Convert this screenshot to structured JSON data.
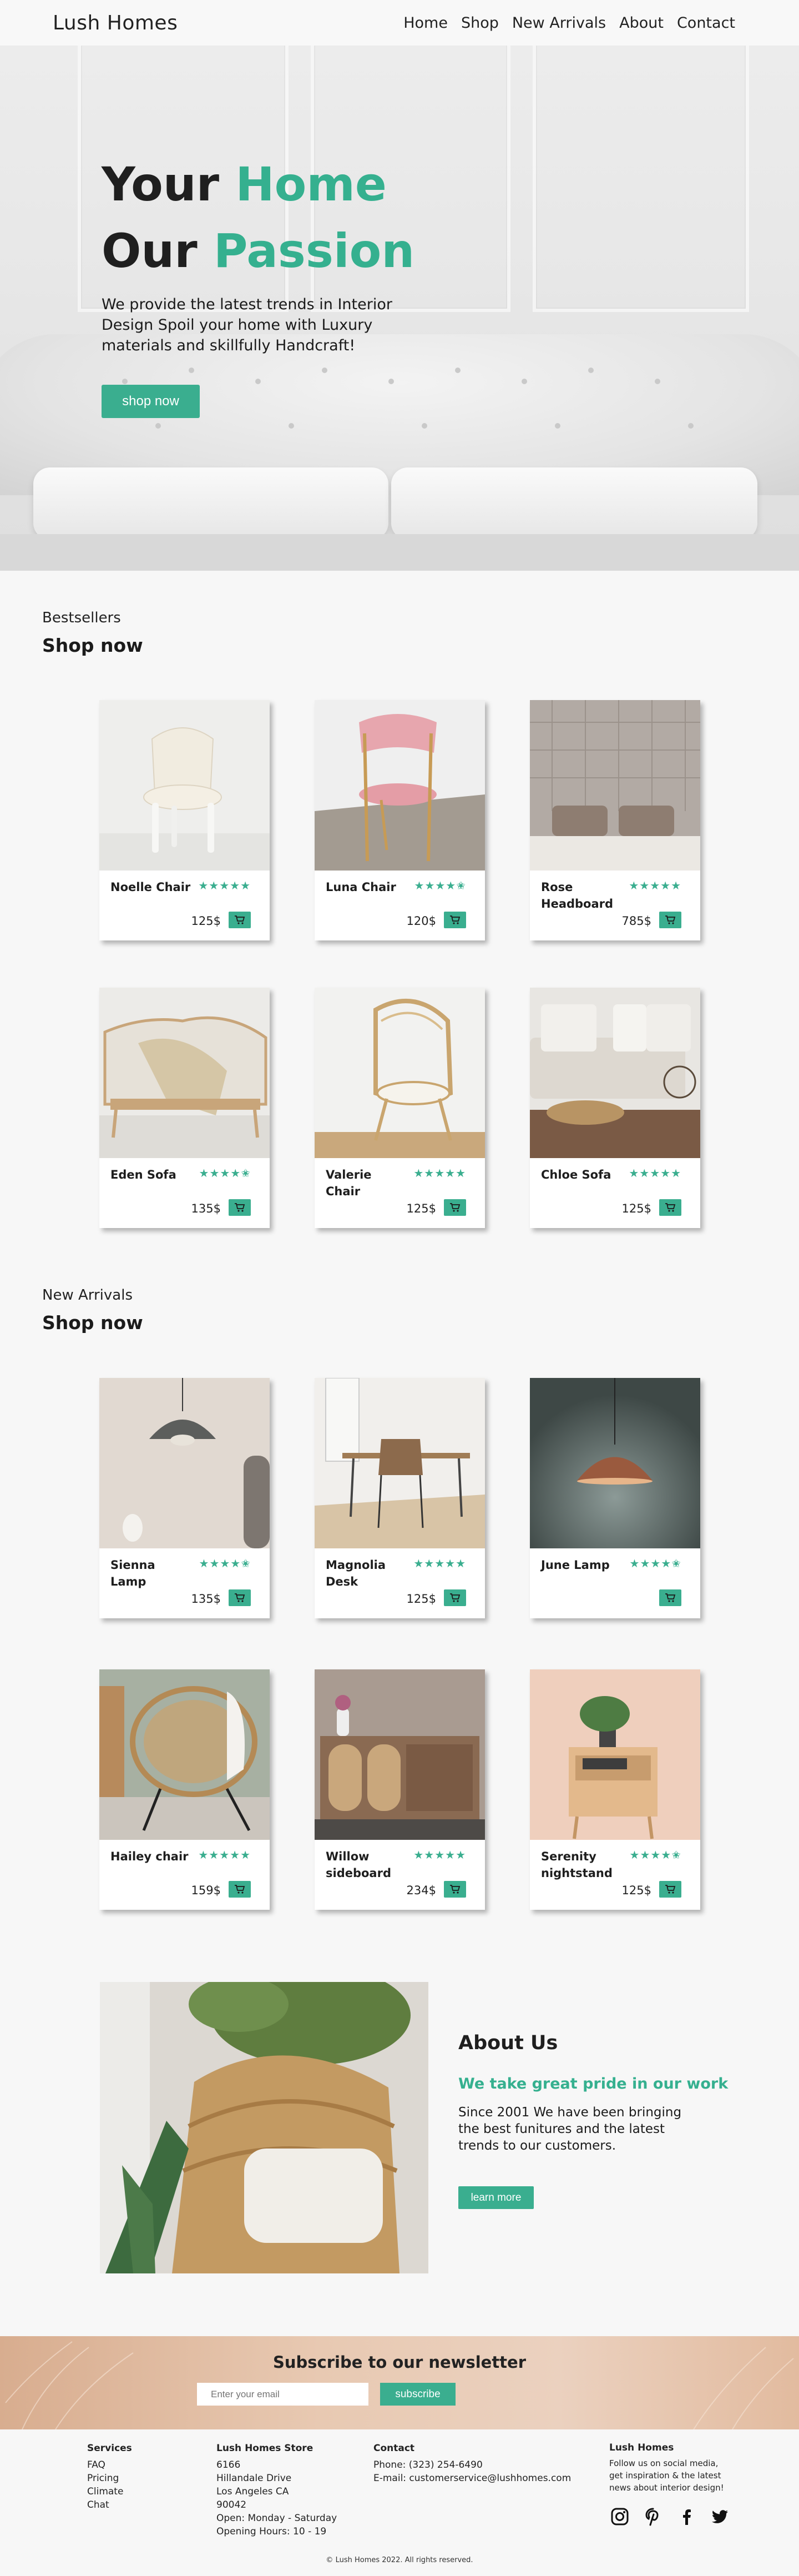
{
  "header": {
    "logo": "Lush Homes",
    "nav": [
      "Home",
      "Shop",
      "New Arrivals",
      "About",
      "Contact"
    ]
  },
  "hero": {
    "line1_a": "Your",
    "line1_b": "Home",
    "line2_a": "Our",
    "line2_b": "Passion",
    "text": "We provide the latest trends in Interior Design Spoil your home with Luxury materials and skillfully Handcraft!",
    "button": "shop now"
  },
  "bestsellers": {
    "subtitle": "Bestsellers",
    "title": "Shop now",
    "products": [
      {
        "name": "Noelle Chair",
        "price": "125$",
        "stars": "★★★★★"
      },
      {
        "name": "Luna Chair",
        "price": "120$",
        "stars": "★★★★✬"
      },
      {
        "name": "Rose Headboard",
        "price": "785$",
        "stars": "★★★★★"
      },
      {
        "name": "Eden Sofa",
        "price": "135$",
        "stars": "★★★★✬"
      },
      {
        "name": "Valerie Chair",
        "price": "125$",
        "stars": "★★★★★"
      },
      {
        "name": "Chloe Sofa",
        "price": "125$",
        "stars": "★★★★★"
      }
    ]
  },
  "new_arrivals": {
    "subtitle": "New Arrivals",
    "title": "Shop now",
    "products": [
      {
        "name": "Sienna Lamp",
        "price": "135$",
        "stars": "★★★★✬"
      },
      {
        "name": "Magnolia Desk",
        "price": "125$",
        "stars": "★★★★★"
      },
      {
        "name": "June Lamp",
        "price": "",
        "stars": "★★★★✬"
      },
      {
        "name": "Hailey chair",
        "price": "159$",
        "stars": "★★★★★"
      },
      {
        "name": "Willow sideboard",
        "price": "234$",
        "stars": "★★★★★"
      },
      {
        "name": "Serenity nightstand",
        "price": "125$",
        "stars": "★★★★✬"
      }
    ]
  },
  "about": {
    "title": "About Us",
    "tagline": "We take great pride in our work",
    "text": "Since 2001 We have been bringing the best funitures and the latest trends to our customers.",
    "button": "learn more"
  },
  "newsletter": {
    "title": "Subscribe to our newsletter",
    "placeholder": "Enter your email",
    "button": "subscribe"
  },
  "footer": {
    "services": {
      "title": "Services",
      "items": [
        "FAQ",
        "Pricing",
        "Climate",
        "Chat"
      ]
    },
    "store": {
      "title": "Lush Homes Store",
      "lines": [
        "6166",
        "Hillandale Drive",
        "Los Angeles CA",
        "90042",
        "Open: Monday - Saturday",
        "Opening Hours: 10 - 19"
      ]
    },
    "contact": {
      "title": "Contact",
      "phone": "Phone: (323) 254-6490",
      "email": "E-mail: customerservice@lushhomes.com"
    },
    "brand": {
      "title": "Lush Homes",
      "text": "Follow us on social media, get inspiration & the latest news about interior design!"
    },
    "social": [
      "instagram-icon",
      "pinterest-icon",
      "facebook-icon",
      "twitter-icon"
    ],
    "copyright": "Lush Homes 2022. All rights reserved."
  },
  "colors": {
    "accent": "#3aae8f",
    "text": "#1f1f1f",
    "background": "#f7f7f7"
  }
}
